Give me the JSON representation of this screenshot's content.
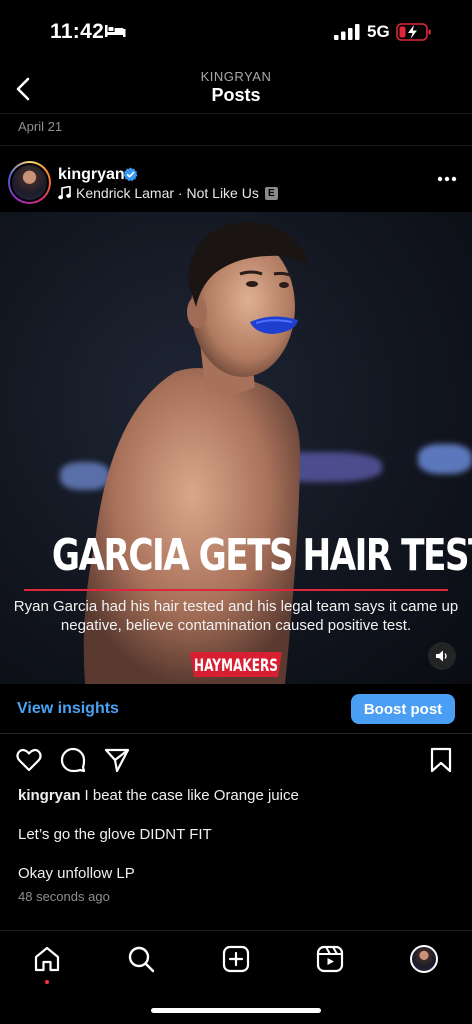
{
  "status_bar": {
    "time": "11:42",
    "network": "5G"
  },
  "header": {
    "subtitle": "KINGRYAN",
    "title": "Posts"
  },
  "date_label": "April 21",
  "post": {
    "username": "kingryan",
    "music": "Kendrick Lamar · Not Like Us",
    "explicit_badge": "E",
    "image": {
      "headline": "GARCIA GETS HAIR TESTED",
      "subtext": "Ryan Garcia had his hair tested and his legal team says it came up negative, believe contamination caused positive test.",
      "brand": "HAYMAKERS"
    },
    "view_insights_label": "View insights",
    "boost_label": "Boost post",
    "caption_user": "kingryan",
    "caption_lines": [
      "I beat the case like Orange juice",
      "Let’s go the glove DIDNT FIT",
      "Okay unfollow LP"
    ],
    "timestamp": "48 seconds ago"
  },
  "colors": {
    "link_blue": "#4aa2f5",
    "boost_blue": "#4a9ff5",
    "accent_red": "#e0263b",
    "notif_dot": "#ff3040"
  },
  "icons": {
    "status": [
      "bed-icon",
      "signal-icon",
      "battery-charging-icon"
    ],
    "header": [
      "back-chevron-icon"
    ],
    "post": [
      "verified-badge-icon",
      "music-note-icon",
      "more-options-icon",
      "sound-icon"
    ],
    "actions": [
      "heart-icon",
      "comment-icon",
      "share-icon",
      "bookmark-icon"
    ],
    "nav": [
      "home-icon",
      "search-icon",
      "create-icon",
      "reels-icon",
      "profile-avatar"
    ]
  }
}
